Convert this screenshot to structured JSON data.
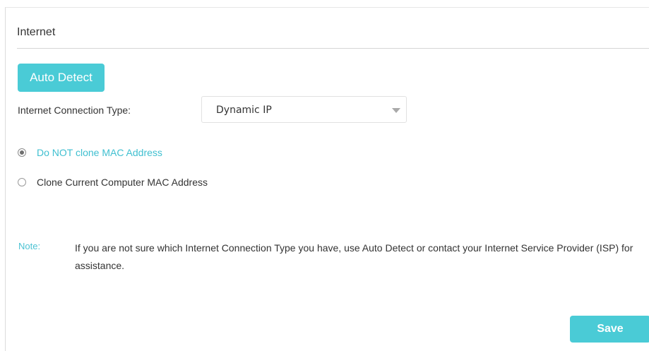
{
  "section": {
    "title": "Internet"
  },
  "auto_detect": {
    "label": "Auto Detect"
  },
  "connection_type": {
    "label": "Internet Connection Type:",
    "selected": "Dynamic IP"
  },
  "mac_options": [
    {
      "label": "Do NOT clone MAC Address",
      "checked": true
    },
    {
      "label": "Clone Current Computer MAC Address",
      "checked": false
    }
  ],
  "note": {
    "label": "Note:",
    "text": "If you are not sure which Internet Connection Type you have, use Auto Detect or contact your Internet Service Provider (ISP) for assistance."
  },
  "save": {
    "label": "Save"
  },
  "colors": {
    "accent": "#4acbd6",
    "active_text": "#3fbfd0"
  }
}
